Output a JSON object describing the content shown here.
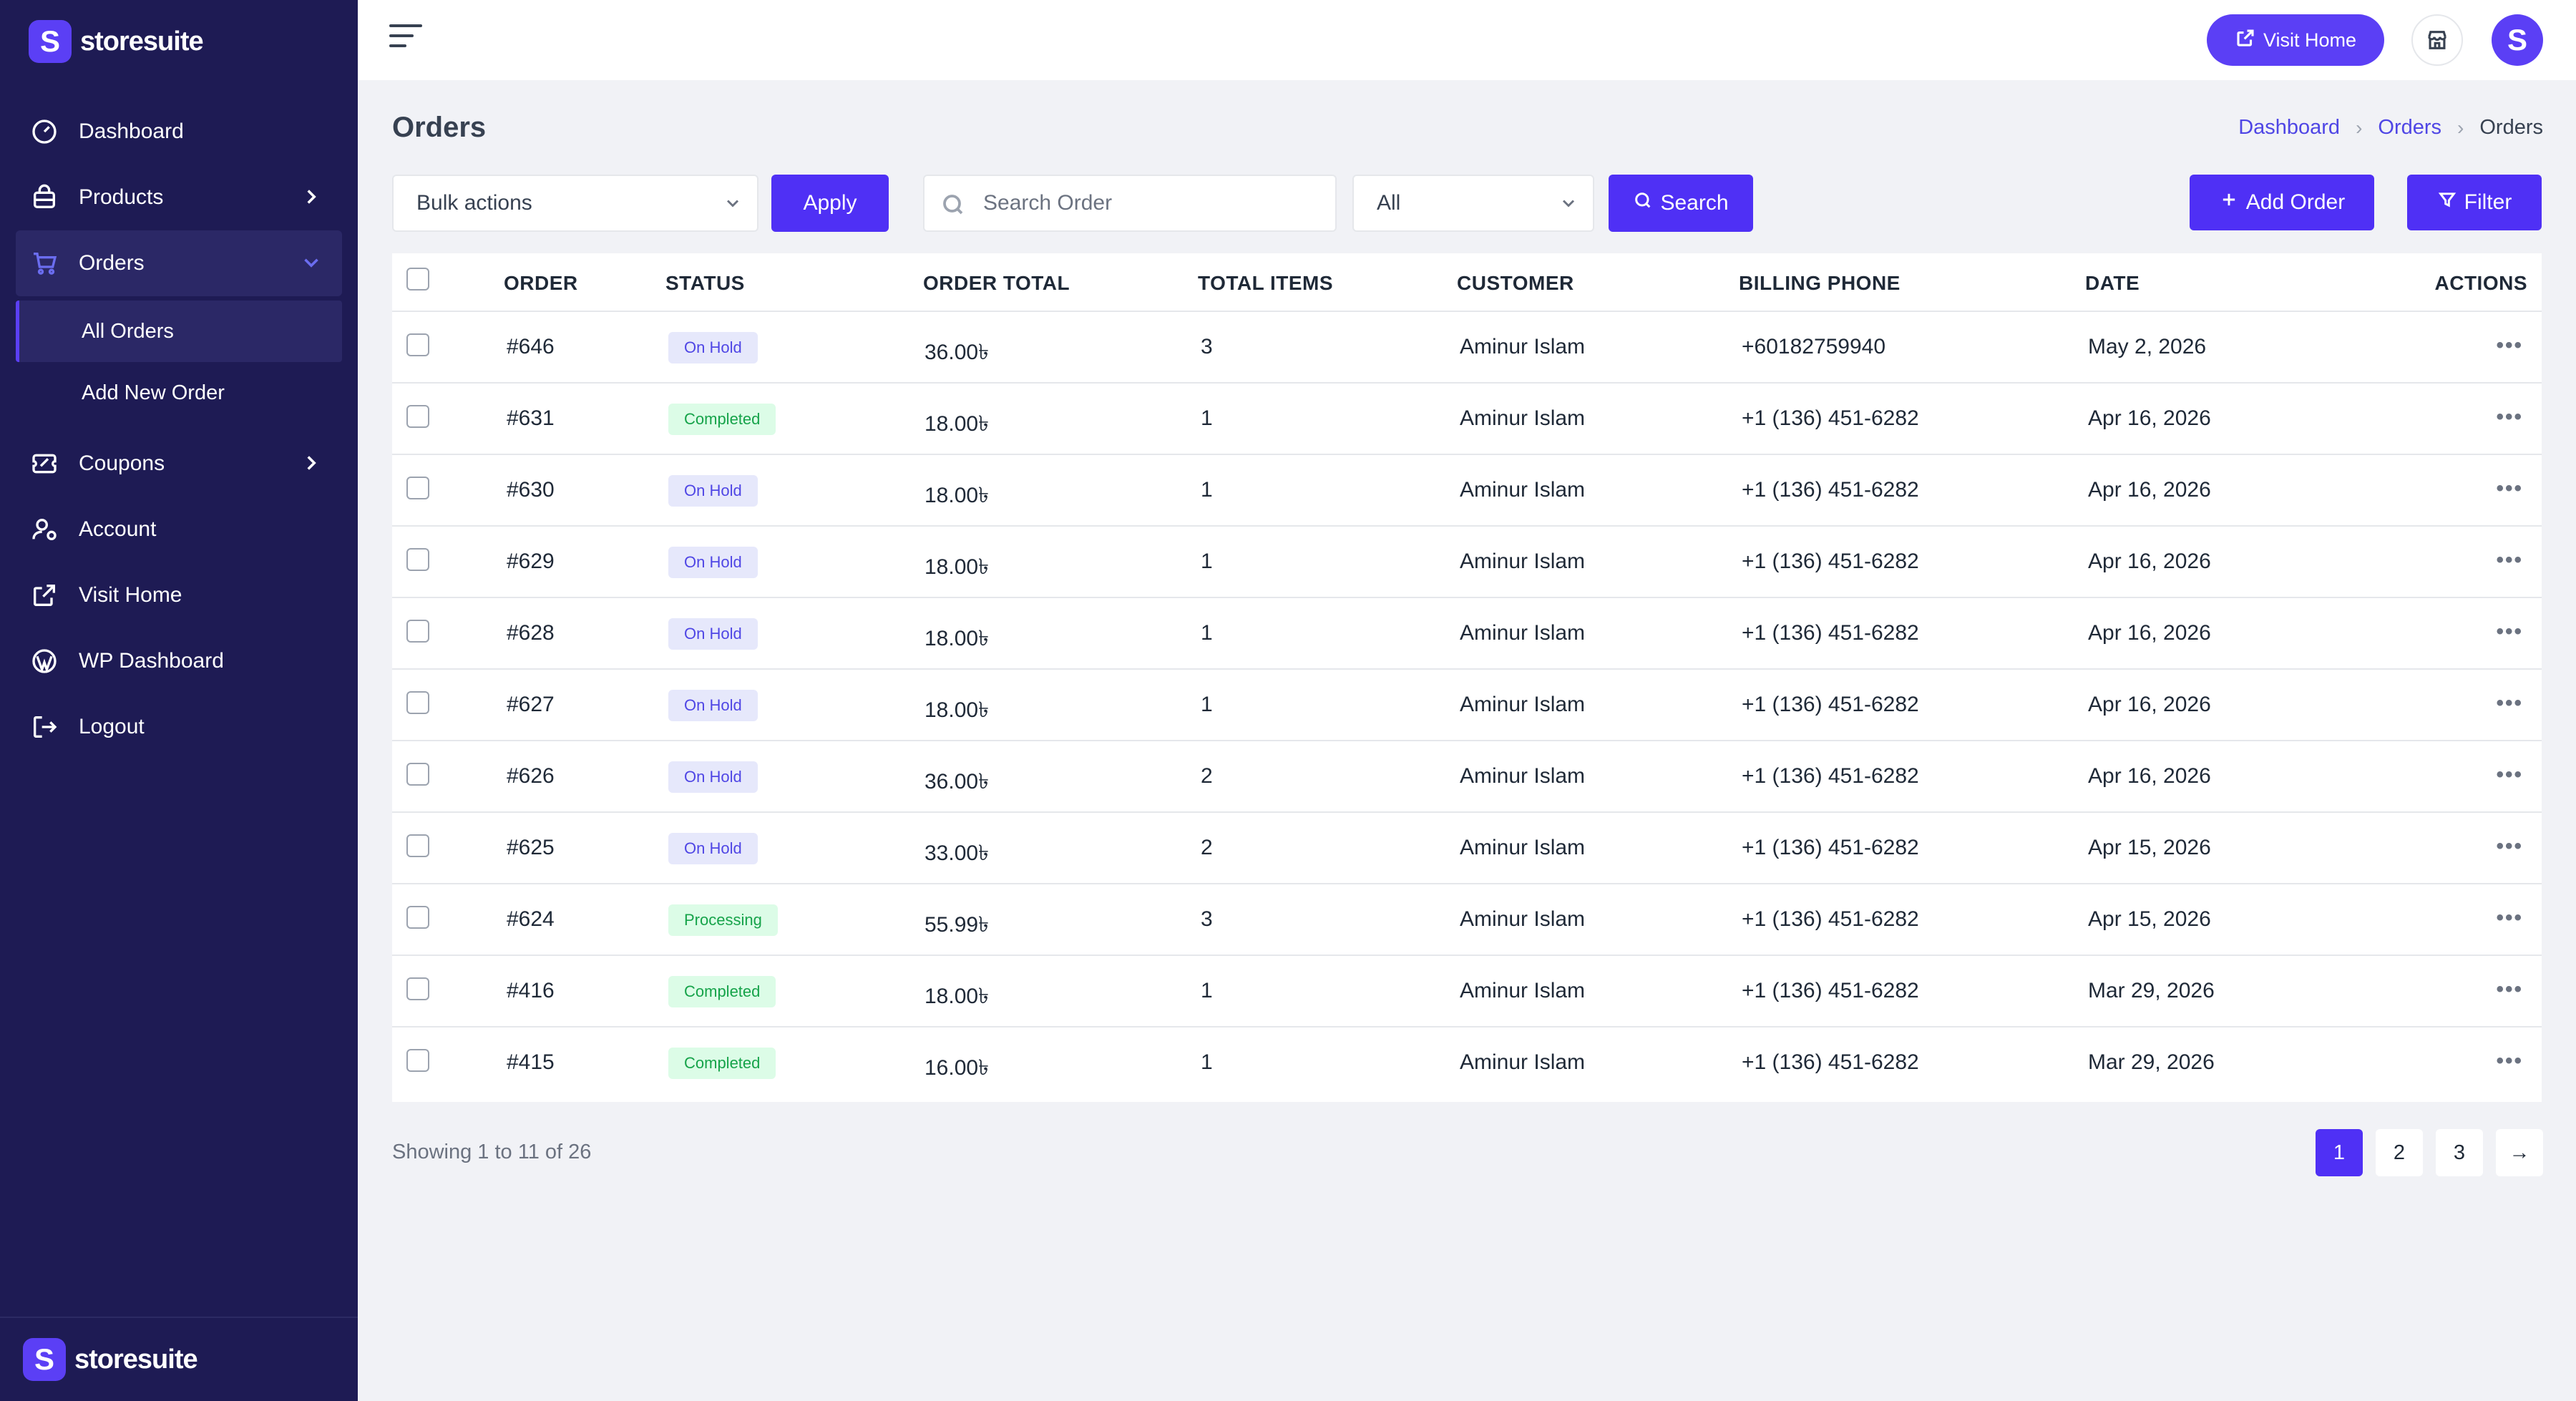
{
  "brand": {
    "name": "storesuite",
    "logo_letter": "S"
  },
  "sidebar": {
    "items": [
      {
        "label": "Dashboard",
        "icon": "gauge-icon"
      },
      {
        "label": "Products",
        "icon": "bag-icon"
      },
      {
        "label": "Orders",
        "icon": "cart-icon"
      },
      {
        "label": "Coupons",
        "icon": "ticket-icon"
      },
      {
        "label": "Account",
        "icon": "user-gear-icon"
      },
      {
        "label": "Visit Home",
        "icon": "external-link-icon"
      },
      {
        "label": "WP Dashboard",
        "icon": "wordpress-icon"
      },
      {
        "label": "Logout",
        "icon": "logout-icon"
      }
    ],
    "orders_sub": [
      {
        "label": "All Orders"
      },
      {
        "label": "Add New Order"
      }
    ]
  },
  "header": {
    "visit_home": "Visit Home",
    "avatar_letter": "S"
  },
  "page": {
    "title": "Orders",
    "breadcrumb": [
      "Dashboard",
      "Orders",
      "Orders"
    ]
  },
  "toolbar": {
    "bulk_actions": "Bulk actions",
    "apply": "Apply",
    "search_placeholder": "Search Order",
    "status_filter": "All",
    "search": "Search",
    "add_order": "Add Order",
    "filter": "Filter"
  },
  "table": {
    "columns": [
      "ORDER",
      "STATUS",
      "ORDER TOTAL",
      "TOTAL ITEMS",
      "CUSTOMER",
      "BILLING PHONE",
      "DATE",
      "ACTIONS"
    ],
    "rows": [
      {
        "order": "#646",
        "status": "On Hold",
        "total": "36.00৳",
        "items": "3",
        "customer": "Aminur Islam",
        "phone": "+60182759940",
        "date": "May 2, 2026"
      },
      {
        "order": "#631",
        "status": "Completed",
        "total": "18.00৳",
        "items": "1",
        "customer": "Aminur Islam",
        "phone": "+1 (136) 451-6282",
        "date": "Apr 16, 2026"
      },
      {
        "order": "#630",
        "status": "On Hold",
        "total": "18.00৳",
        "items": "1",
        "customer": "Aminur Islam",
        "phone": "+1 (136) 451-6282",
        "date": "Apr 16, 2026"
      },
      {
        "order": "#629",
        "status": "On Hold",
        "total": "18.00৳",
        "items": "1",
        "customer": "Aminur Islam",
        "phone": "+1 (136) 451-6282",
        "date": "Apr 16, 2026"
      },
      {
        "order": "#628",
        "status": "On Hold",
        "total": "18.00৳",
        "items": "1",
        "customer": "Aminur Islam",
        "phone": "+1 (136) 451-6282",
        "date": "Apr 16, 2026"
      },
      {
        "order": "#627",
        "status": "On Hold",
        "total": "18.00৳",
        "items": "1",
        "customer": "Aminur Islam",
        "phone": "+1 (136) 451-6282",
        "date": "Apr 16, 2026"
      },
      {
        "order": "#626",
        "status": "On Hold",
        "total": "36.00৳",
        "items": "2",
        "customer": "Aminur Islam",
        "phone": "+1 (136) 451-6282",
        "date": "Apr 16, 2026"
      },
      {
        "order": "#625",
        "status": "On Hold",
        "total": "33.00৳",
        "items": "2",
        "customer": "Aminur Islam",
        "phone": "+1 (136) 451-6282",
        "date": "Apr 15, 2026"
      },
      {
        "order": "#624",
        "status": "Processing",
        "total": "55.99৳",
        "items": "3",
        "customer": "Aminur Islam",
        "phone": "+1 (136) 451-6282",
        "date": "Apr 15, 2026"
      },
      {
        "order": "#416",
        "status": "Completed",
        "total": "18.00৳",
        "items": "1",
        "customer": "Aminur Islam",
        "phone": "+1 (136) 451-6282",
        "date": "Mar 29, 2026"
      },
      {
        "order": "#415",
        "status": "Completed",
        "total": "16.00৳",
        "items": "1",
        "customer": "Aminur Islam",
        "phone": "+1 (136) 451-6282",
        "date": "Mar 29, 2026"
      }
    ],
    "actions_glyph": "•••"
  },
  "pagination": {
    "showing": "Showing 1 to 11 of 26",
    "pages": [
      "1",
      "2",
      "3"
    ],
    "next": "→",
    "current": "1"
  },
  "colors": {
    "sidebar_bg": "#1e1b54",
    "accent": "#4f30f5",
    "on_hold_bg": "#e6e8fb",
    "completed_bg": "#dcfce7"
  }
}
